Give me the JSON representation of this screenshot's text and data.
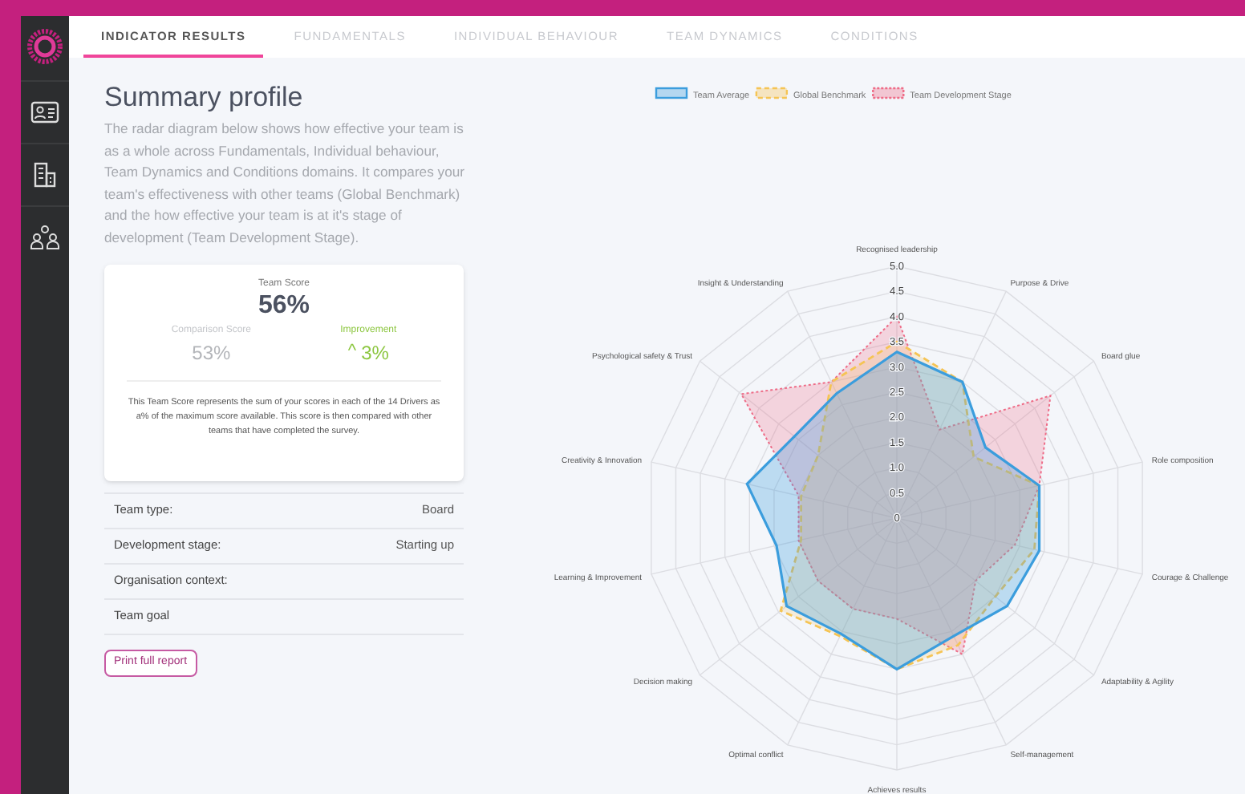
{
  "tabs": [
    {
      "label": "INDICATOR RESULTS",
      "selected": true
    },
    {
      "label": "FUNDAMENTALS",
      "selected": false
    },
    {
      "label": "INDIVIDUAL BEHAVIOUR",
      "selected": false
    },
    {
      "label": "TEAM DYNAMICS",
      "selected": false
    },
    {
      "label": "CONDITIONS",
      "selected": false
    }
  ],
  "summary": {
    "title": "Summary profile",
    "description": "The radar diagram below shows how effective your team is as a whole across Fundamentals, Individual behaviour, Team Dynamics and Conditions domains. It compares your team's effectiveness with other teams (Global Benchmark) and the how effective your team is at it's stage of development (Team Development Stage)."
  },
  "score_card": {
    "team_score_label": "Team Score",
    "team_score": "56%",
    "comparison_label": "Comparison Score",
    "comparison_score": "53%",
    "improvement_label": "Improvement",
    "improvement_icon": "^",
    "improvement": "3%",
    "note": "This Team Score represents the sum of your scores in each of the 14 Drivers as a% of the maximum score available. This score is then compared with other teams that have completed the survey."
  },
  "details": [
    {
      "label": "Team type:",
      "value": "Board"
    },
    {
      "label": "Development stage:",
      "value": "Starting up"
    },
    {
      "label": "Organisation context:"
    },
    {
      "label": "Team goal"
    }
  ],
  "print_button": "Print full report",
  "chart_data": {
    "type": "radar",
    "legend": "top",
    "categories": [
      "Recognised leadership",
      "Purpose & Drive",
      "Board glue",
      "Role composition",
      "Courage & Challenge",
      "Adaptability & Agility",
      "Self-management",
      "Achieves results",
      "Optimal conflict",
      "Decision making",
      "Learning & Improvement",
      "Creativity & Innovation",
      "Psychological safety & Trust",
      "Insight & Understanding"
    ],
    "ylim": [
      0,
      5
    ],
    "yticks": [
      {
        "value": 0,
        "label": "0"
      },
      {
        "value": 0.5,
        "label": "0.5"
      },
      {
        "value": 1,
        "label": "1.0"
      },
      {
        "value": 1.5,
        "label": "1.5"
      },
      {
        "value": 2,
        "label": "2.0"
      },
      {
        "value": 2.5,
        "label": "2.5"
      },
      {
        "value": 3,
        "label": "3.0"
      },
      {
        "value": 3.5,
        "label": "3.5"
      },
      {
        "value": 4,
        "label": "4.0"
      },
      {
        "value": 4.5,
        "label": "4.5"
      },
      {
        "value": 5,
        "label": "5.0"
      }
    ],
    "series": [
      {
        "name": "Team Average",
        "color": "#3b9ddd",
        "values": [
          3.3,
          3.0,
          2.25,
          2.9,
          2.9,
          2.8,
          2.6,
          3.0,
          2.55,
          2.8,
          2.45,
          3.05,
          2.6,
          2.75
        ]
      },
      {
        "name": "Global Benchmark",
        "color": "#f5c454",
        "values": [
          3.5,
          3.0,
          1.95,
          2.9,
          2.8,
          2.5,
          2.8,
          3.0,
          2.6,
          2.95,
          1.95,
          1.95,
          2.0,
          3.0
        ]
      },
      {
        "name": "Team Development Stage",
        "color": "#ee6c87",
        "values": [
          4.0,
          1.95,
          3.9,
          2.9,
          2.4,
          2.0,
          3.0,
          2.0,
          2.0,
          2.0,
          2.0,
          2.0,
          3.95,
          3.0
        ]
      }
    ]
  }
}
